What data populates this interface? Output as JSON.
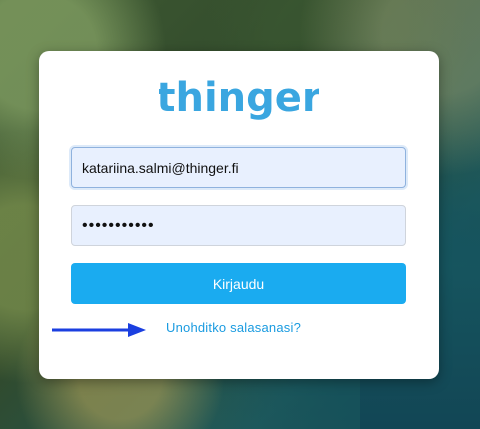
{
  "brand": {
    "name": "thinger",
    "color": "#3aa6e0"
  },
  "form": {
    "email_value": "katariina.salmi@thinger.fi",
    "password_masked": "•••••••••••",
    "login_label": "Kirjaudu",
    "forgot_label": "Unohditko salasanasi?"
  },
  "colors": {
    "accent": "#1aabf0",
    "arrow": "#1b3fe0"
  },
  "icons": {
    "arrow": "arrow-right-icon"
  }
}
